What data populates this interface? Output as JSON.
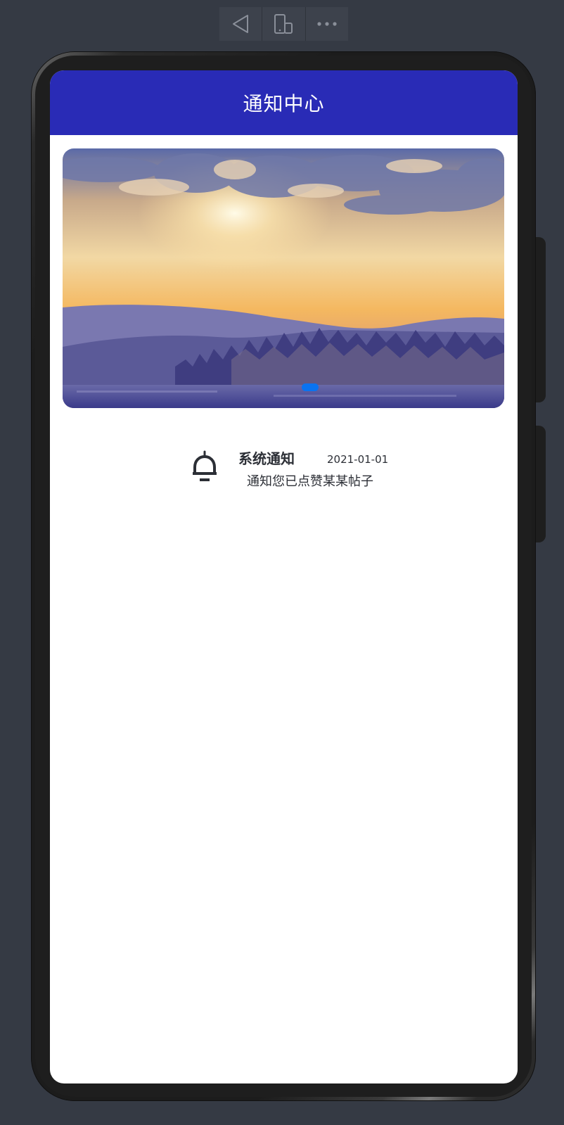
{
  "toolbar": {
    "buttons": [
      {
        "icon": "back-triangle-icon"
      },
      {
        "icon": "rotate-device-icon"
      },
      {
        "icon": "more-dots-icon"
      }
    ]
  },
  "app": {
    "title": "通知中心"
  },
  "banner": {
    "image": "sunset-over-lake-and-forest",
    "active_indicator_color": "#0a73f0"
  },
  "notifications": [
    {
      "icon": "bell-icon",
      "title": "系统通知",
      "date": "2021-01-01",
      "message": "通知您已点赞某某帖子"
    }
  ],
  "colors": {
    "header": "#292bb6",
    "background": "#353a44",
    "text": "#2c2f36"
  }
}
